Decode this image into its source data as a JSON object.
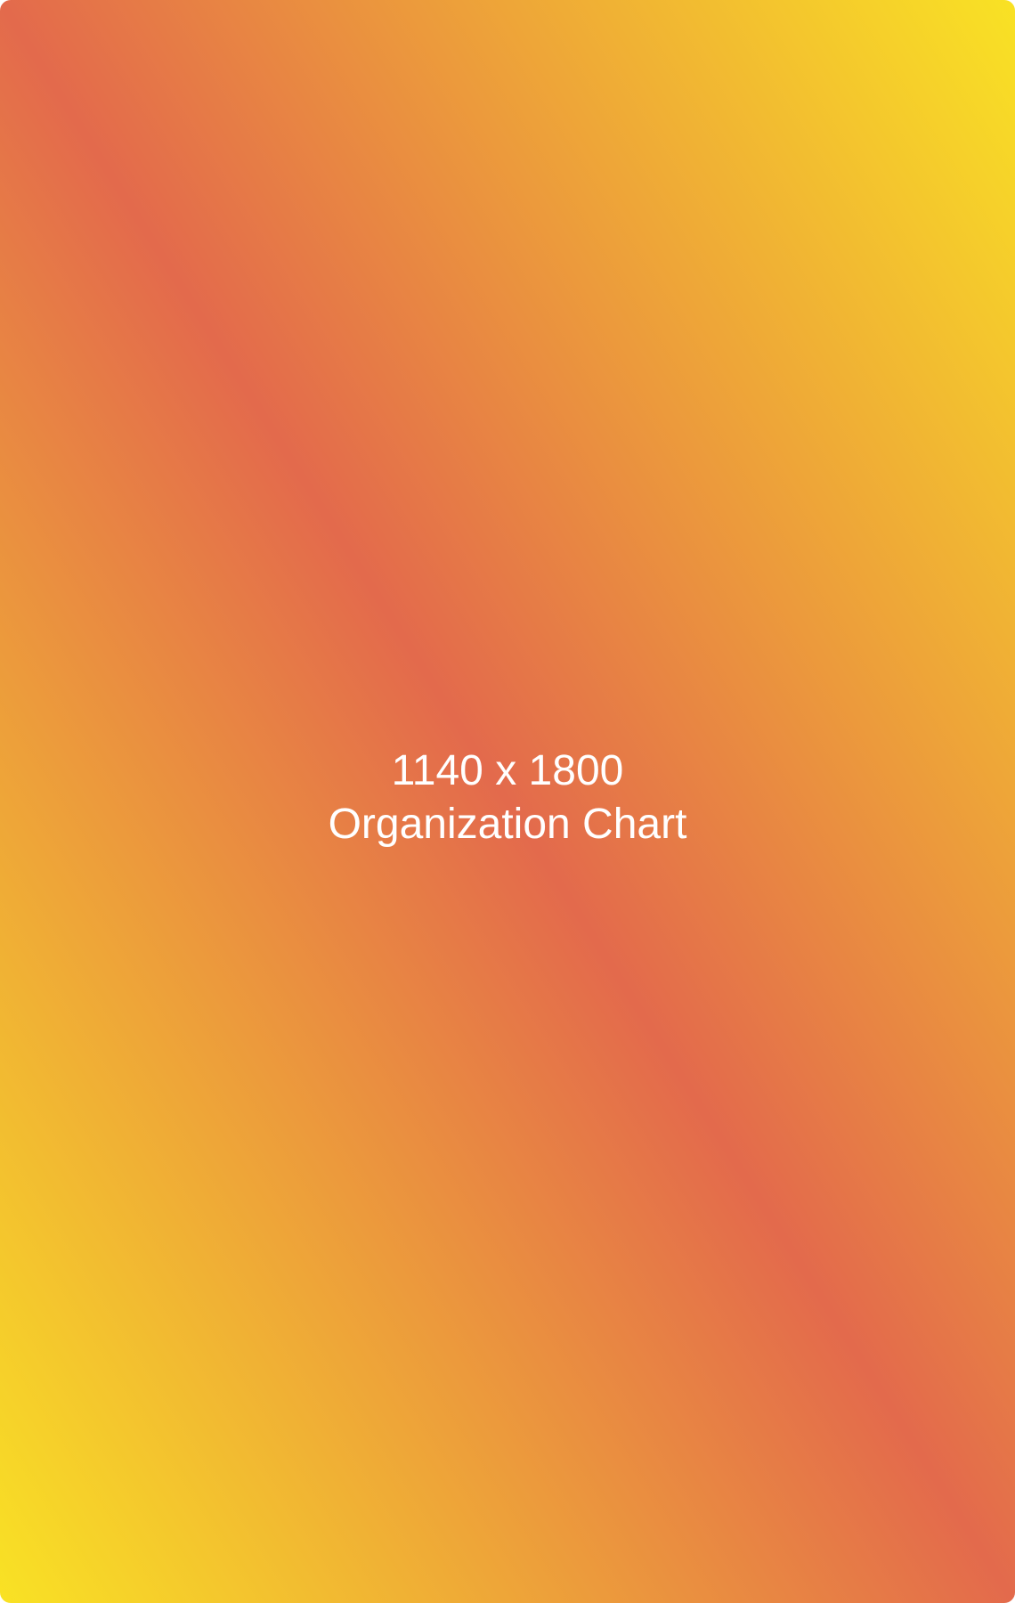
{
  "placeholder": {
    "dimensions_text": "1140 x 1800",
    "label": "Organization Chart",
    "colors": {
      "gradient_edge": "#f9e224",
      "gradient_center": "#e36a4c",
      "text": "#ffffff"
    }
  }
}
